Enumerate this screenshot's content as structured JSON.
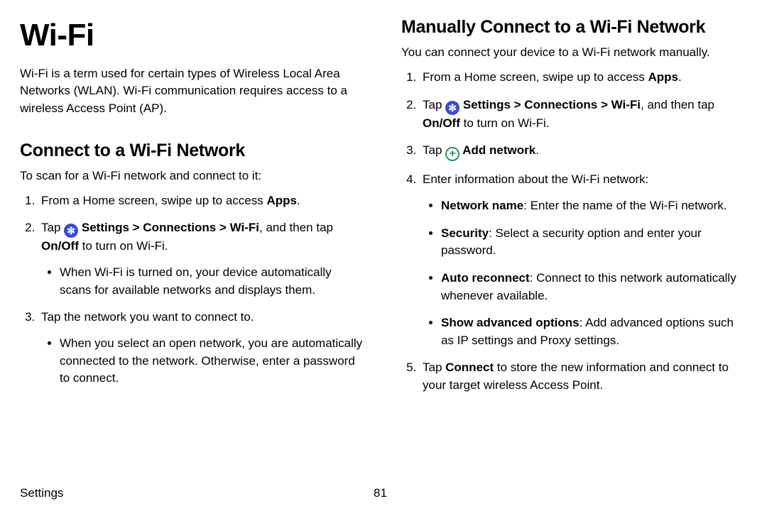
{
  "page": {
    "title": "Wi-Fi",
    "intro": "Wi-Fi is a term used for certain types of Wireless Local Area Networks (WLAN). Wi-Fi communication requires access to a wireless Access Point (AP)."
  },
  "connect": {
    "heading": "Connect to a Wi-Fi Network",
    "lead": "To scan for a Wi-Fi network and connect to it:",
    "step1_a": "From a Home screen, swipe up to access ",
    "step1_b": "Apps",
    "step1_c": ".",
    "step2_a": "Tap ",
    "step2_b": " Settings > Connections > Wi-Fi",
    "step2_c": ", and then tap ",
    "step2_d": "On/Off",
    "step2_e": " to turn on Wi-Fi.",
    "step2_sub": "When Wi-Fi is turned on, your device automatically scans for available networks and displays them.",
    "step3": "Tap the network you want to connect to.",
    "step3_sub": "When you select an open network, you are automatically connected to the network. Otherwise, enter a password to connect."
  },
  "manual": {
    "heading": "Manually Connect to a Wi-Fi Network",
    "lead": "You can connect your device to a Wi-Fi network manually.",
    "step1_a": "From a Home screen, swipe up to access ",
    "step1_b": "Apps",
    "step1_c": ".",
    "step2_a": "Tap ",
    "step2_b": " Settings > Connections > Wi-Fi",
    "step2_c": ", and then tap ",
    "step2_d": "On/Off",
    "step2_e": " to turn on Wi-Fi.",
    "step3_a": "Tap ",
    "step3_b": " Add network",
    "step3_c": ".",
    "step4": "Enter information about the Wi-Fi network:",
    "b1_a": "Network name",
    "b1_b": ": Enter the name of the Wi-Fi network.",
    "b2_a": "Security",
    "b2_b": ": Select a security option and enter your password.",
    "b3_a": "Auto reconnect",
    "b3_b": ": Connect to this network automatically whenever available.",
    "b4_a": "Show advanced options",
    "b4_b": ": Add advanced options such as IP settings and Proxy settings.",
    "step5_a": "Tap ",
    "step5_b": "Connect",
    "step5_c": " to store the new information and connect to your target wireless Access Point."
  },
  "footer": {
    "section": "Settings",
    "page_number": "81"
  }
}
